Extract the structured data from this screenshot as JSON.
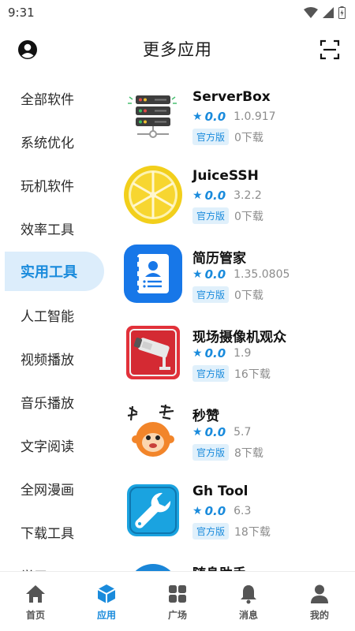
{
  "status": {
    "time": "9:31"
  },
  "header": {
    "title": "更多应用"
  },
  "sidebar": {
    "items": [
      {
        "label": "全部软件"
      },
      {
        "label": "系统优化"
      },
      {
        "label": "玩机软件"
      },
      {
        "label": "效率工具"
      },
      {
        "label": "实用工具",
        "active": true
      },
      {
        "label": "人工智能"
      },
      {
        "label": "视频播放"
      },
      {
        "label": "音乐播放"
      },
      {
        "label": "文字阅读"
      },
      {
        "label": "全网漫画"
      },
      {
        "label": "下载工具"
      },
      {
        "label": "学习"
      }
    ]
  },
  "apps": [
    {
      "name": "ServerBox",
      "rating": "0.0",
      "version": "1.0.917",
      "tag": "官方版",
      "downloads": "0下载",
      "icon": "server-rack-icon"
    },
    {
      "name": "JuiceSSH",
      "rating": "0.0",
      "version": "3.2.2",
      "tag": "官方版",
      "downloads": "0下载",
      "icon": "lemon-icon"
    },
    {
      "name": "简历管家",
      "rating": "0.0",
      "version": "1.35.0805",
      "tag": "官方版",
      "downloads": "0下载",
      "icon": "resume-icon"
    },
    {
      "name": "现场摄像机观众",
      "rating": "0.0",
      "version": "1.9",
      "tag": "官方版",
      "downloads": "16下载",
      "icon": "security-camera-icon"
    },
    {
      "name": "秒赞",
      "rating": "0.0",
      "version": "5.7",
      "tag": "官方版",
      "downloads": "8下载",
      "icon": "monkey-icon"
    },
    {
      "name": "Gh Tool",
      "rating": "0.0",
      "version": "6.3",
      "tag": "官方版",
      "downloads": "18下载",
      "icon": "wrench-icon"
    },
    {
      "name": "随身助手",
      "icon": "assistant-icon"
    }
  ],
  "nav": {
    "items": [
      {
        "label": "首页",
        "icon": "home-icon"
      },
      {
        "label": "应用",
        "icon": "apps-cube-icon",
        "active": true
      },
      {
        "label": "广场",
        "icon": "grid-icon"
      },
      {
        "label": "消息",
        "icon": "bell-icon"
      },
      {
        "label": "我的",
        "icon": "person-icon"
      }
    ]
  },
  "colors": {
    "accent": "#1a8bdc",
    "active_bg": "#dcedfb",
    "nav_inactive": "#555555"
  }
}
